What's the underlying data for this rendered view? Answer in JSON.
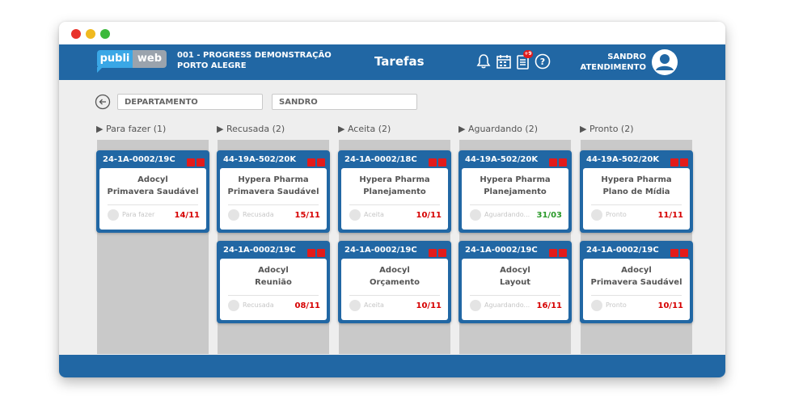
{
  "window": {
    "controls": [
      "close",
      "minimize",
      "maximize"
    ]
  },
  "header": {
    "logo": {
      "left": "publi",
      "right": "web"
    },
    "company_line1": "001 - PROGRESS DEMONSTRAÇÃO",
    "company_line2": "PORTO ALEGRE",
    "title": "Tarefas",
    "icons": [
      "bell-icon",
      "calendar-icon",
      "document-icon",
      "help-icon"
    ],
    "notification_badge": "+9",
    "user_line1": "SANDRO",
    "user_line2": "ATENDIMENTO"
  },
  "filters": {
    "department": "DEPARTAMENTO",
    "user": "SANDRO"
  },
  "columns": [
    {
      "header": "▶ Para fazer (1)",
      "cards": [
        {
          "code": "24-1A-0002/19C",
          "line1": "Adocyl",
          "line2": "Primavera Saudável",
          "status": "Para fazer",
          "date": "14/11",
          "date_color": "#d60000"
        }
      ]
    },
    {
      "header": "▶ Recusada (2)",
      "cards": [
        {
          "code": "44-19A-502/20K",
          "line1": "Hypera Pharma",
          "line2": "Primavera Saudável",
          "status": "Recusada",
          "date": "15/11",
          "date_color": "#d60000"
        },
        {
          "code": "24-1A-0002/19C",
          "line1": "Adocyl",
          "line2": "Reunião",
          "status": "Recusada",
          "date": "08/11",
          "date_color": "#d60000"
        }
      ]
    },
    {
      "header": "▶ Aceita (2)",
      "cards": [
        {
          "code": "24-1A-0002/18C",
          "line1": "Hypera Pharma",
          "line2": "Planejamento",
          "status": "Aceita",
          "date": "10/11",
          "date_color": "#d60000"
        },
        {
          "code": "24-1A-0002/19C",
          "line1": "Adocyl",
          "line2": "Orçamento",
          "status": "Aceita",
          "date": "10/11",
          "date_color": "#d60000"
        }
      ]
    },
    {
      "header": "▶ Aguardando (2)",
      "cards": [
        {
          "code": "44-19A-502/20K",
          "line1": "Hypera Pharma",
          "line2": "Planejamento",
          "status": "Aguardando...",
          "date": "31/03",
          "date_color": "#2a9a2a"
        },
        {
          "code": "24-1A-0002/19C",
          "line1": "Adocyl",
          "line2": "Layout",
          "status": "Aguardando...",
          "date": "16/11",
          "date_color": "#d60000"
        }
      ]
    },
    {
      "header": "▶ Pronto (2)",
      "cards": [
        {
          "code": "44-19A-502/20K",
          "line1": "Hypera Pharma",
          "line2": "Plano de Mídia",
          "status": "Pronto",
          "date": "11/11",
          "date_color": "#d60000"
        },
        {
          "code": "24-1A-0002/19C",
          "line1": "Adocyl",
          "line2": "Primavera Saudável",
          "status": "Pronto",
          "date": "10/11",
          "date_color": "#d60000"
        }
      ]
    }
  ],
  "colors": {
    "brand_blue": "#2167a4",
    "logo_blue": "#3aa7e6",
    "flag_red": "#e21b1b",
    "date_red": "#d60000",
    "date_green": "#2a9a2a"
  }
}
